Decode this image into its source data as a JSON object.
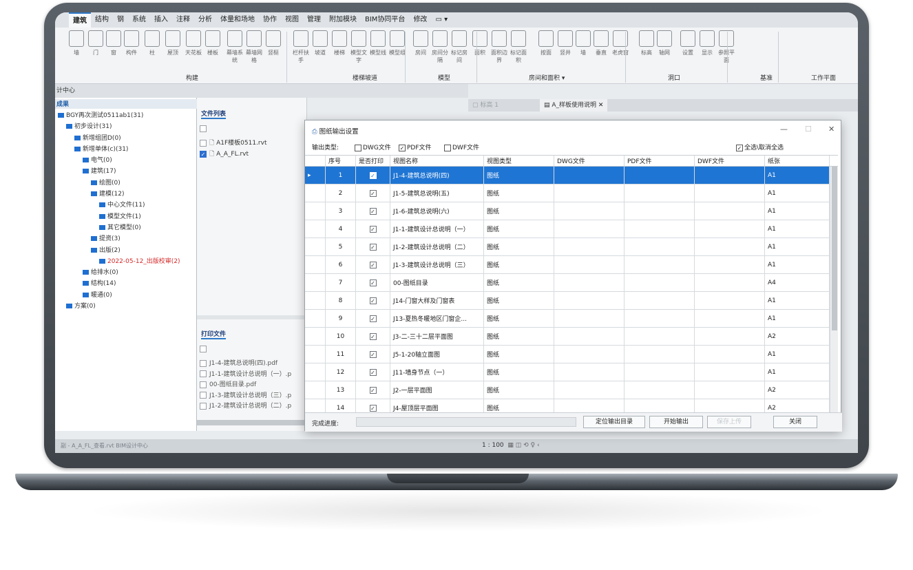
{
  "ribbon": {
    "tabs": [
      "建筑",
      "结构",
      "钢",
      "系统",
      "插入",
      "注释",
      "分析",
      "体量和场地",
      "协作",
      "视图",
      "管理",
      "附加模块",
      "BIM协同平台",
      "修改"
    ],
    "tools": [
      "墙",
      "门",
      "窗",
      "构件",
      "柱",
      "屋顶",
      "天花板",
      "楼板",
      "幕墙系统",
      "幕墙网格",
      "竖梃",
      "栏杆扶手",
      "坡道",
      "楼梯",
      "模型文字",
      "模型线",
      "模型组",
      "房间",
      "房间分隔",
      "标记房间",
      "面积",
      "面积边界",
      "标记面积",
      "按面",
      "竖井",
      "墙",
      "垂直",
      "老虎窗",
      "标高",
      "轴网",
      "设置",
      "显示",
      "参照平面"
    ],
    "groups": [
      "构建",
      "楼梯坡道",
      "模型",
      "房间和面积 ▾",
      "洞口",
      "基准",
      "工作平面"
    ]
  },
  "left": {
    "pane_title": "计中心",
    "results_label": "成果",
    "tree": [
      {
        "label": "BGY再次测试0511ab1(31)",
        "indent": 0,
        "red": false
      },
      {
        "label": "初步设计(31)",
        "indent": 1,
        "red": false
      },
      {
        "label": "新增组团D(0)",
        "indent": 2,
        "red": false
      },
      {
        "label": "新增单体(c)(31)",
        "indent": 2,
        "red": false
      },
      {
        "label": "电气(0)",
        "indent": 3,
        "red": false
      },
      {
        "label": "建筑(17)",
        "indent": 3,
        "red": false
      },
      {
        "label": "绘图(0)",
        "indent": 4,
        "red": false
      },
      {
        "label": "建模(12)",
        "indent": 4,
        "red": false
      },
      {
        "label": "中心文件(11)",
        "indent": 5,
        "red": false
      },
      {
        "label": "模型文件(1)",
        "indent": 5,
        "red": false
      },
      {
        "label": "其它模型(0)",
        "indent": 5,
        "red": false
      },
      {
        "label": "提资(3)",
        "indent": 4,
        "red": false
      },
      {
        "label": "出版(2)",
        "indent": 4,
        "red": false
      },
      {
        "label": "2022-05-12_出版校审(2)",
        "indent": 5,
        "red": true
      },
      {
        "label": "给排水(0)",
        "indent": 3,
        "red": false
      },
      {
        "label": "结构(14)",
        "indent": 3,
        "red": false
      },
      {
        "label": "暖通(0)",
        "indent": 3,
        "red": false
      },
      {
        "label": "方案(0)",
        "indent": 1,
        "red": false
      }
    ]
  },
  "filelist": {
    "title": "文件列表",
    "files": [
      {
        "name": "A1F楼板0511.rvt",
        "checked": false
      },
      {
        "name": "A_A_FL.rvt",
        "checked": true
      }
    ],
    "print_title": "打印文件",
    "print_files": [
      "J1-4-建筑总说明(四).pdf",
      "J1-1-建筑设计总说明（一）.p",
      "00-图纸目录.pdf",
      "J1-3-建筑设计总说明（三）.p",
      "J1-2-建筑设计总说明（二）.p"
    ]
  },
  "doc_tabs": [
    "标高 1",
    "A_样板使用说明"
  ],
  "status": {
    "left": "副 - A_A_FL_查看.rvt   BIM设计中心",
    "scale": "1 : 100"
  },
  "dialog": {
    "title": "图纸输出设置",
    "output_type_label": "输出类型:",
    "options": [
      {
        "label": "DWG文件",
        "checked": false
      },
      {
        "label": "PDF文件",
        "checked": true
      },
      {
        "label": "DWF文件",
        "checked": false
      }
    ],
    "select_all": "全选\\取消全选",
    "columns": [
      "序号",
      "是否打印",
      "视图名称",
      "视图类型",
      "DWG文件",
      "PDF文件",
      "DWF文件",
      "纸张"
    ],
    "rows": [
      {
        "no": "1",
        "name": "J1-4-建筑总说明(四)",
        "type": "图纸",
        "paper": "A1"
      },
      {
        "no": "2",
        "name": "J1-5-建筑总说明(五)",
        "type": "图纸",
        "paper": "A1"
      },
      {
        "no": "3",
        "name": "J1-6-建筑总说明(六)",
        "type": "图纸",
        "paper": "A1"
      },
      {
        "no": "4",
        "name": "J1-1-建筑设计总说明（一）",
        "type": "图纸",
        "paper": "A1"
      },
      {
        "no": "5",
        "name": "J1-2-建筑设计总说明（二）",
        "type": "图纸",
        "paper": "A1"
      },
      {
        "no": "6",
        "name": "J1-3-建筑设计总说明（三）",
        "type": "图纸",
        "paper": "A1"
      },
      {
        "no": "7",
        "name": "00-图纸目录",
        "type": "图纸",
        "paper": "A4"
      },
      {
        "no": "8",
        "name": "J14-门窗大样及门窗表",
        "type": "图纸",
        "paper": "A1"
      },
      {
        "no": "9",
        "name": "J13-夏热冬暖地区门窗企...",
        "type": "图纸",
        "paper": "A1"
      },
      {
        "no": "10",
        "name": "J3-二-三十二层平面图",
        "type": "图纸",
        "paper": "A2"
      },
      {
        "no": "11",
        "name": "J5-1-20轴立面图",
        "type": "图纸",
        "paper": "A1"
      },
      {
        "no": "12",
        "name": "J11-墙身节点（一）",
        "type": "图纸",
        "paper": "A1"
      },
      {
        "no": "13",
        "name": "J2-一层平面图",
        "type": "图纸",
        "paper": "A2"
      },
      {
        "no": "14",
        "name": "J4-屋顶层平面图",
        "type": "图纸",
        "paper": "A2"
      }
    ],
    "progress_label": "完成进度:",
    "buttons": [
      "定位输出目录",
      "开始输出",
      "保存上传",
      "关闭"
    ]
  }
}
